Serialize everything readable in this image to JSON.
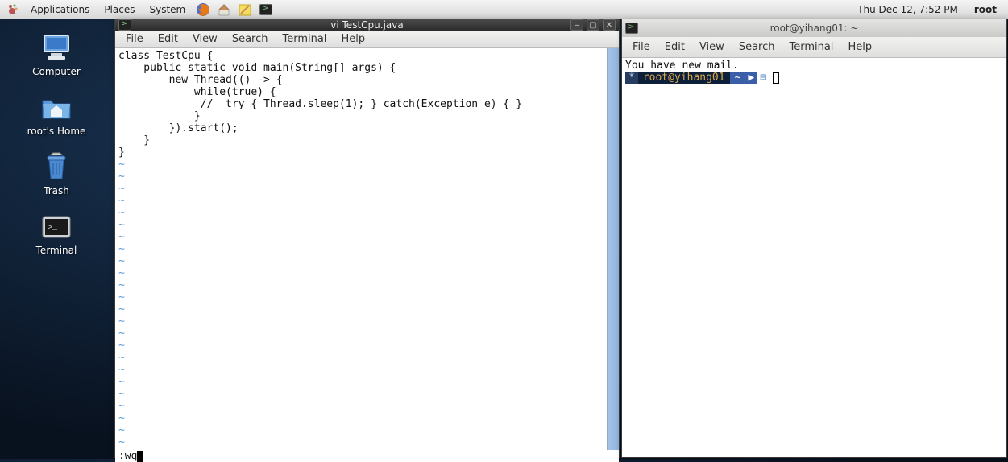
{
  "panel": {
    "applications": "Applications",
    "places": "Places",
    "system": "System",
    "clock": "Thu Dec 12,  7:52 PM",
    "user": "root"
  },
  "desktop": {
    "computer": "Computer",
    "home": "root's Home",
    "trash": "Trash",
    "terminal": "Terminal"
  },
  "menus": {
    "file": "File",
    "edit": "Edit",
    "view": "View",
    "search": "Search",
    "terminal": "Terminal",
    "help": "Help"
  },
  "vi_window": {
    "title": "vi TestCpu.java",
    "code": "class TestCpu {\n    public static void main(String[] args) {\n        new Thread(() -> {\n            while(true) {\n             //  try { Thread.sleep(1); } catch(Exception e) { }\n            }\n        }).start();\n    }\n}",
    "tildes": "~\n~\n~\n~\n~\n~\n~\n~\n~\n~\n~\n~\n~\n~\n~\n~\n~\n~\n~\n~\n~\n~\n~\n~",
    "status": ":wq"
  },
  "term_window": {
    "title": "root@yihang01: ~",
    "mail": "You have new mail.",
    "prompt_star": "*",
    "prompt_user": "root@yihang01",
    "prompt_path": "~",
    "prompt_dash": "⊟"
  }
}
